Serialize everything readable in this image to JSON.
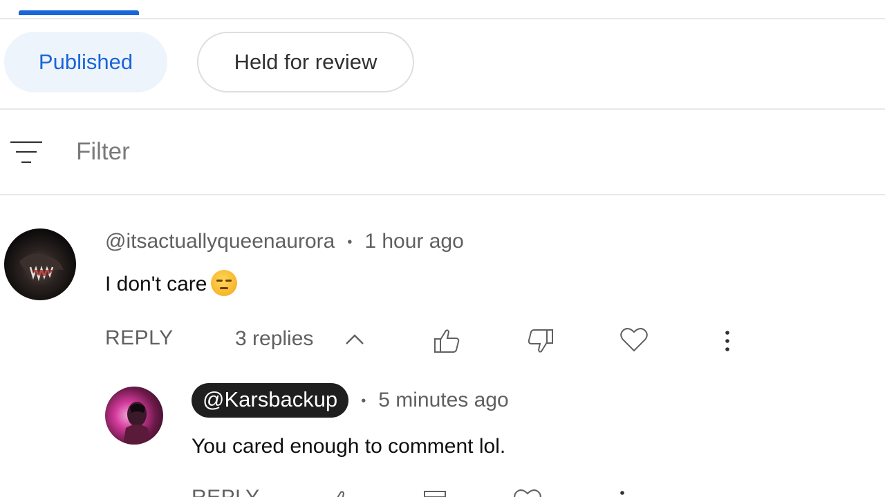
{
  "tabs": {
    "chips": [
      {
        "label": "Published",
        "selected": true
      },
      {
        "label": "Held for review",
        "selected": false
      }
    ]
  },
  "filter": {
    "placeholder": "Filter"
  },
  "comment": {
    "author": "@itsactuallyqueenaurora",
    "separator": "•",
    "time": "1 hour ago",
    "text": "I don't care",
    "reply_label": "REPLY",
    "replies_label": "3 replies",
    "emoji": "unamused-face"
  },
  "reply": {
    "author": "@Karsbackup",
    "separator": "•",
    "time": "5 minutes ago",
    "text": "You cared enough to comment lol.",
    "reply_label": "REPLY"
  },
  "icons": {
    "filter": "filter-lines-icon",
    "collapse": "chevron-up-icon",
    "like": "thumbs-up-icon",
    "dislike": "thumbs-down-icon",
    "heart": "heart-icon",
    "more": "more-vert-icon"
  },
  "colors": {
    "accent": "#1a65d8",
    "chip_selected_bg": "#eef4fc",
    "text_secondary": "#606060",
    "badge_bg": "#1f1f1f"
  }
}
